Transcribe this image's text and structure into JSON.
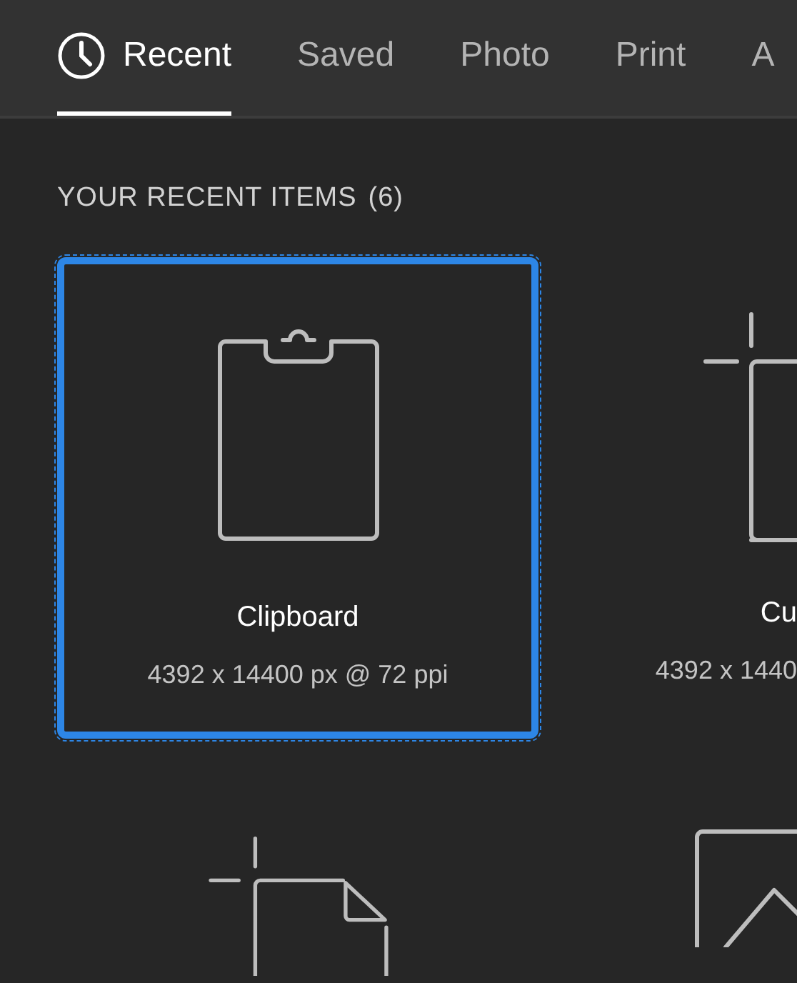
{
  "tabs": [
    {
      "label": "Recent",
      "selected": true,
      "icon": true
    },
    {
      "label": "Saved",
      "selected": false
    },
    {
      "label": "Photo",
      "selected": false
    },
    {
      "label": "Print",
      "selected": false
    },
    {
      "label": "A",
      "selected": false
    }
  ],
  "section": {
    "title": "YOUR RECENT ITEMS",
    "count": "(6)"
  },
  "items": [
    {
      "kind": "clipboard",
      "selected": true,
      "title": "Clipboard",
      "details": "4392 x 14400 px @ 72 ppi"
    },
    {
      "kind": "custom",
      "selected": false,
      "title": "Cu",
      "details": "4392 x 1440"
    },
    {
      "kind": "document",
      "selected": false
    },
    {
      "kind": "image",
      "selected": false
    }
  ]
}
